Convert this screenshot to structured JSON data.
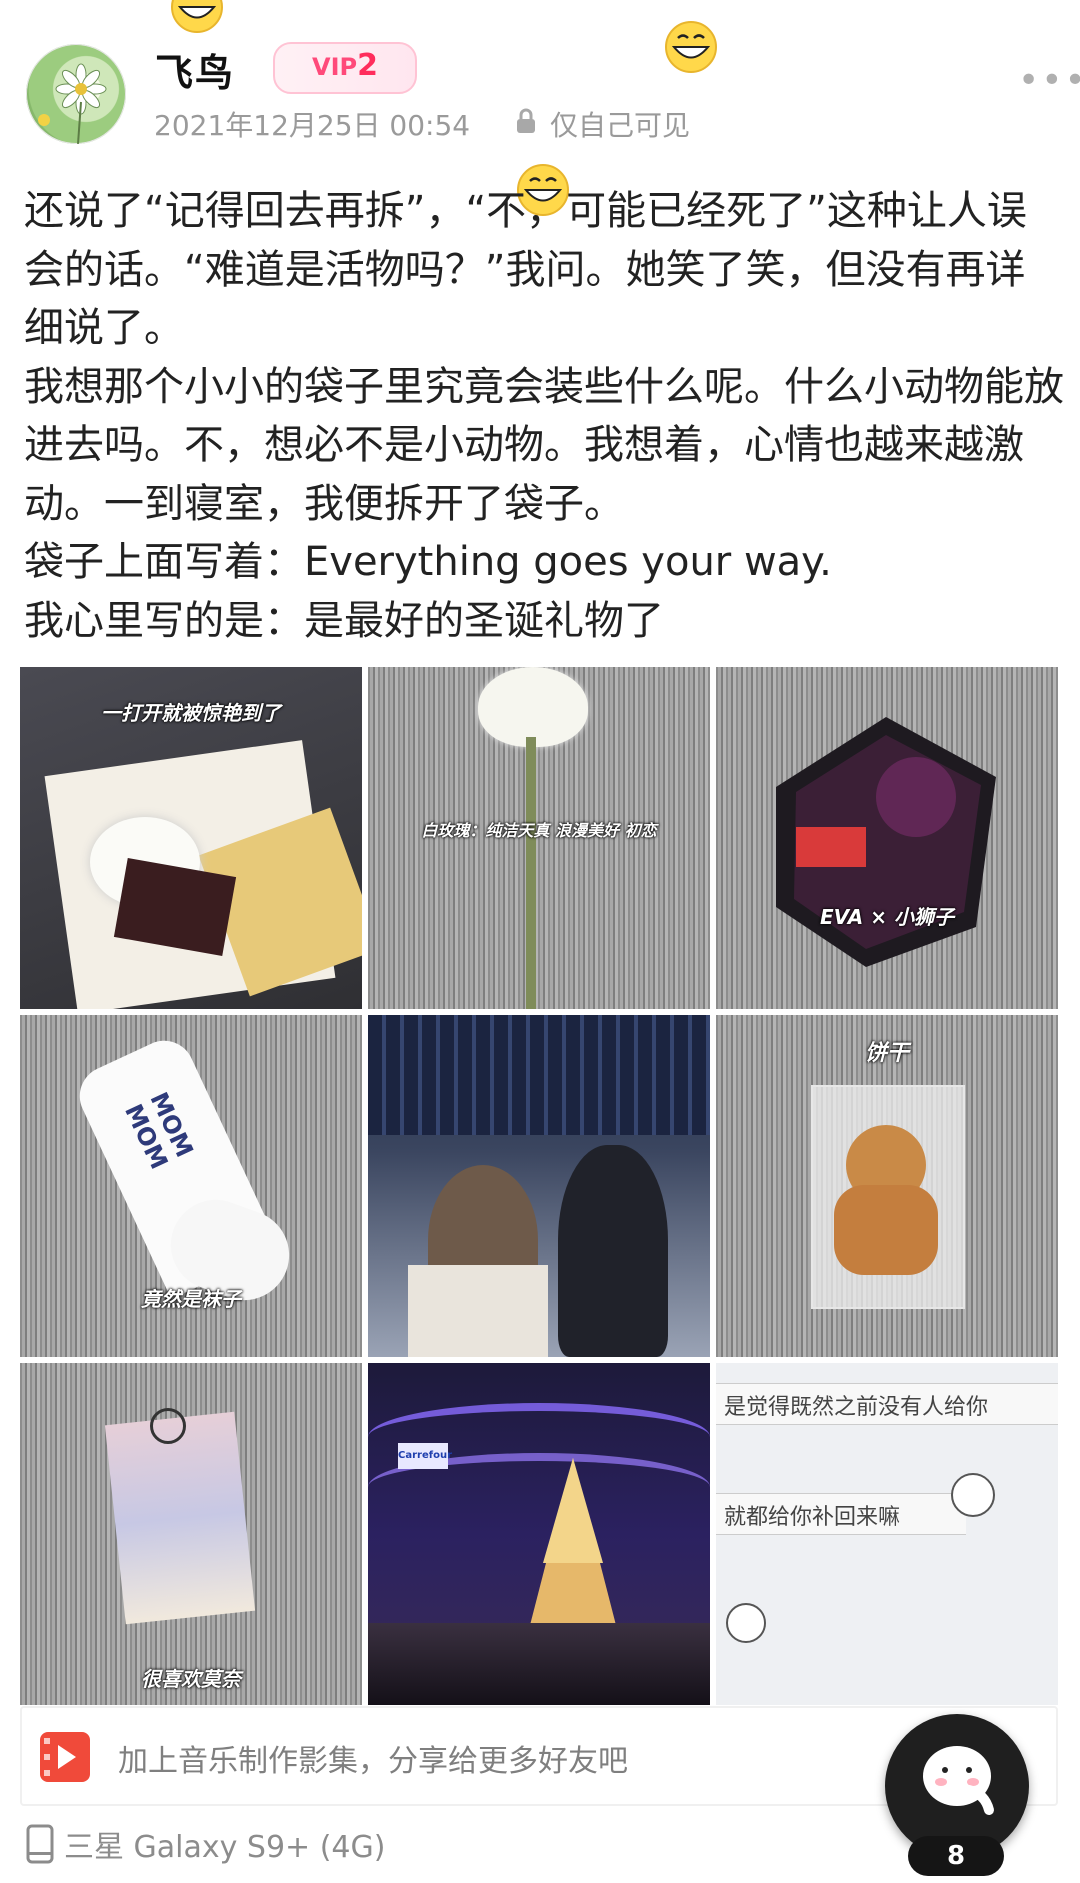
{
  "post": {
    "username": "飞鸟",
    "vip_label": "VIP",
    "vip_level": "2",
    "timestamp": "2021年12月25日 00:54",
    "privacy": "仅自己可见",
    "more_icon": "more-dots-icon"
  },
  "content": {
    "lines": [
      "还说了“记得回去再拆”，“不，可能已经死了”这种让人误会的话。“难道是活物吗？”我问。她笑了笑，但没有再详细说了。",
      "我想那个小小的袋子里究竟会装些什么呢。什么小动物能放进去吗。不，想必不是小动物。我想着，心情也越来越激动。一到寝室，我便拆开了袋子。",
      "袋子上面写着：Everything goes your way.",
      "我心里写的是：是最好的圣诞礼物了"
    ]
  },
  "photos": {
    "captions": [
      "一打开就被惊艳到了",
      "白玫瑰：纯洁天真 浪漫美好 初恋",
      "EVA × 小狮子",
      "竟然是袜子",
      "",
      "饼干",
      "很喜欢莫奈",
      "",
      "是觉得既然之前没有人给你"
    ],
    "extra_text": {
      "socks_print": "MOM MOM",
      "handwriting_line2": "就都给你补回来嘛",
      "store_sign": "Carrefour"
    }
  },
  "music": {
    "text": "加上音乐制作影集，分享给更多好友吧"
  },
  "device": {
    "label": "三星 Galaxy S9+ (4G)"
  },
  "fab": {
    "count": "8"
  },
  "colors": {
    "vip_pink": "#ff4a7a",
    "music_red": "#f04a3a",
    "meta_gray": "#9a9a9a"
  }
}
